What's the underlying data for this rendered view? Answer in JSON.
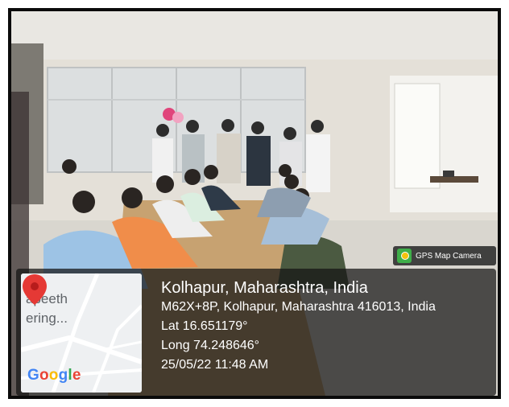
{
  "gps_badge": {
    "label": "GPS Map Camera",
    "icon": "gps-map-camera-logo-icon"
  },
  "map": {
    "label_top": "apeeth",
    "label_bottom": "ering...",
    "brand": "Google",
    "pin_icon": "map-pin-icon",
    "pin_color": "#e53935"
  },
  "location": {
    "city": "Kolhapur, Maharashtra, India",
    "address": "M62X+8P, Kolhapur, Maharashtra 416013, India",
    "lat": "Lat 16.651179°",
    "long": "Long 74.248646°",
    "datetime": "25/05/22 11:48 AM"
  },
  "colors": {
    "frame": "#0b0b0b",
    "overlay": "rgba(20,20,20,0.72)",
    "google_blue": "#4285f4",
    "google_red": "#ea4335",
    "google_yellow": "#fbbc05",
    "google_green": "#34a853"
  }
}
